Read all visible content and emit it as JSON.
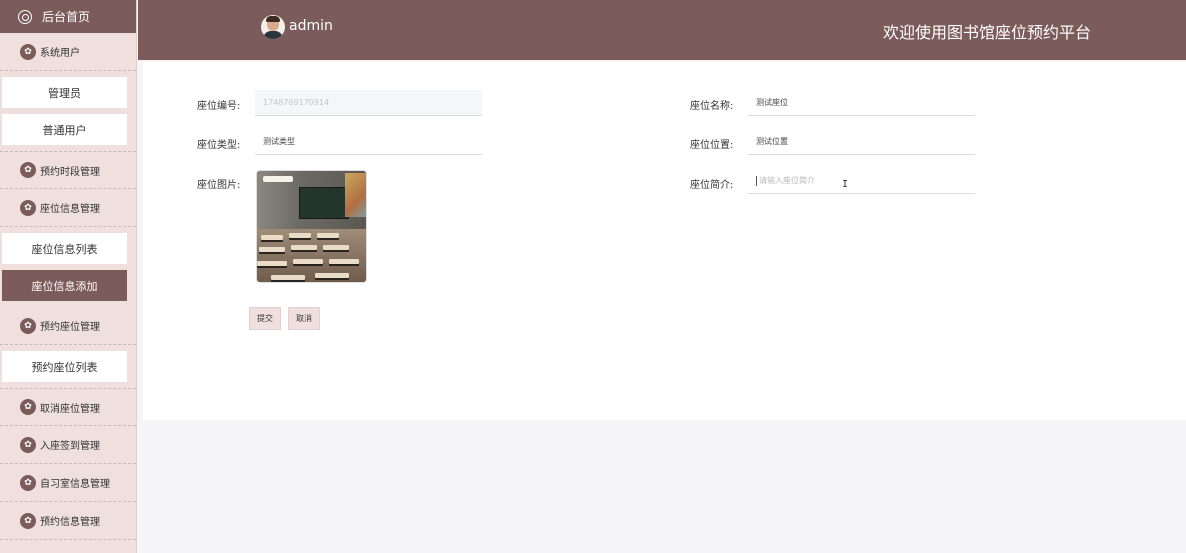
{
  "sidebar": {
    "home_label": "后台首页",
    "sections": [
      {
        "label": "系统用户",
        "children": [
          "管理员",
          "普通用户"
        ]
      },
      {
        "label": "预约时段管理",
        "children": []
      },
      {
        "label": "座位信息管理",
        "children": [
          "座位信息列表",
          "座位信息添加"
        ]
      },
      {
        "label": "预约座位管理",
        "children": [
          "预约座位列表"
        ]
      },
      {
        "label": "取消座位管理",
        "children": []
      },
      {
        "label": "入座签到管理",
        "children": []
      },
      {
        "label": "自习室信息管理",
        "children": []
      },
      {
        "label": "预约信息管理",
        "children": []
      }
    ],
    "active_item": "座位信息添加"
  },
  "header": {
    "username": "admin",
    "title": "欢迎使用图书馆座位预约平台"
  },
  "form": {
    "seat_no": {
      "label": "座位编号:",
      "value": "1748769170914"
    },
    "seat_name": {
      "label": "座位名称:",
      "value": "测试座位"
    },
    "seat_type": {
      "label": "座位类型:",
      "value": "测试类型"
    },
    "seat_location": {
      "label": "座位位置:",
      "value": "测试位置"
    },
    "seat_image": {
      "label": "座位图片:"
    },
    "seat_intro": {
      "label": "座位简介:",
      "placeholder": "请输入座位简介"
    },
    "submit_label": "提交",
    "cancel_label": "取消"
  },
  "colors": {
    "brand": "#7c5c5b",
    "sidebar_bg": "#efe0de"
  },
  "icons": {
    "home": "home-ring-icon",
    "menu": "menu-flower-icon"
  }
}
